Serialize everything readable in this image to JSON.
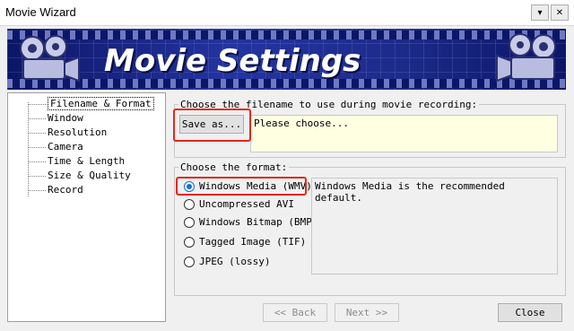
{
  "window": {
    "title": "Movie Wizard",
    "dropdown_glyph": "▾",
    "close_glyph": "✕"
  },
  "banner": {
    "title": "Movie Settings"
  },
  "tree": {
    "items": [
      {
        "label": "Filename & Format",
        "selected": true
      },
      {
        "label": "Window"
      },
      {
        "label": "Resolution"
      },
      {
        "label": "Camera"
      },
      {
        "label": "Time & Length"
      },
      {
        "label": "Size & Quality"
      },
      {
        "label": "Record"
      }
    ]
  },
  "filename_group": {
    "label": "Choose the filename to use during movie recording:",
    "save_button": "Save as...",
    "filename_value": "Please choose..."
  },
  "format_group": {
    "label": "Choose the format:",
    "options": [
      {
        "label": "Windows Media (WMV)",
        "checked": true
      },
      {
        "label": "Uncompressed AVI",
        "checked": false
      },
      {
        "label": "Windows Bitmap (BMP)",
        "checked": false
      },
      {
        "label": "Tagged Image (TIF)",
        "checked": false
      },
      {
        "label": "JPEG (lossy)",
        "checked": false
      }
    ],
    "description": "Windows Media is the recommended default."
  },
  "footer": {
    "back_button": "<< Back",
    "next_button": "Next >>",
    "close_button": "Close"
  },
  "colors": {
    "highlight": "#e8271c",
    "radio_checked": "#0f6fd8",
    "filename_bg": "#ffffe1",
    "banner": "#1c2b8a"
  }
}
